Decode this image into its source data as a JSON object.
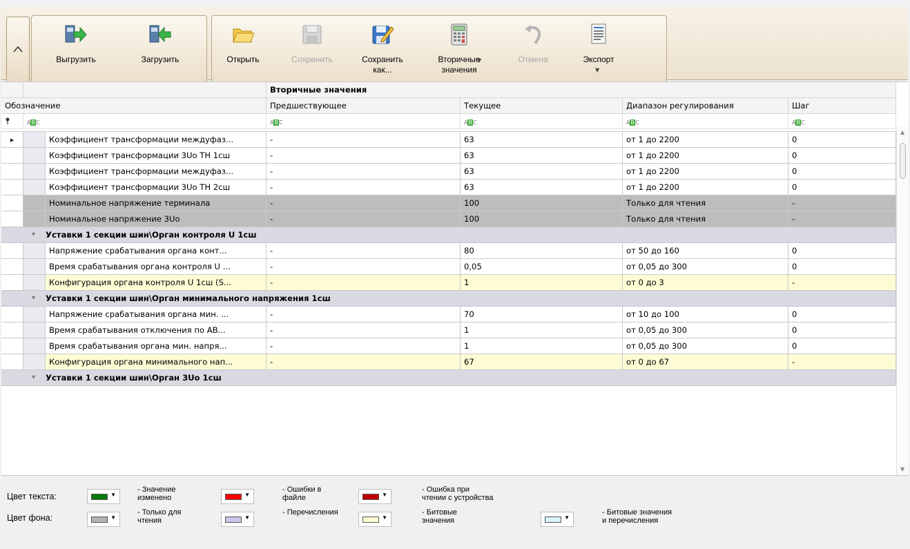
{
  "ribbon": {
    "collapse_glyph": "^",
    "buttons": [
      {
        "label": "Выгрузить",
        "icon": "upload-icon",
        "enabled": true
      },
      {
        "label": "Загрузить",
        "icon": "download-icon",
        "enabled": true
      },
      {
        "label": "Открыть",
        "icon": "folder-icon",
        "enabled": true
      },
      {
        "label": "Сохранить",
        "icon": "save-icon",
        "enabled": false
      },
      {
        "label": "Сохранить\nкак...",
        "icon": "save-as-icon",
        "enabled": true
      },
      {
        "label": "Вторичные\nзначения",
        "icon": "calculator-icon",
        "enabled": true
      },
      {
        "label": "Отмена",
        "icon": "undo-icon",
        "enabled": false
      },
      {
        "label": "Экспорт",
        "icon": "export-icon",
        "enabled": true
      }
    ]
  },
  "grid": {
    "band_header": "Вторичные значения",
    "columns": [
      "Обозначение",
      "Предшествующее",
      "Текущее",
      "Диапазон регулирования",
      "Шаг"
    ],
    "filter_icon": "ABC",
    "rows": [
      {
        "kind": "data",
        "style": "normal",
        "current": true,
        "name": "Коэффициент трансформации междуфаз...",
        "prev": "-",
        "cur": "63",
        "range": "от 1 до 2200",
        "step": "0"
      },
      {
        "kind": "data",
        "style": "normal",
        "name": "Коэффициент трансформации 3Uo ТН 1сш",
        "prev": "-",
        "cur": "63",
        "range": "от 1 до 2200",
        "step": "0"
      },
      {
        "kind": "data",
        "style": "normal",
        "name": "Коэффициент трансформации междуфаз...",
        "prev": "-",
        "cur": "63",
        "range": "от 1 до 2200",
        "step": "0"
      },
      {
        "kind": "data",
        "style": "normal",
        "name": "Коэффициент трансформации 3Uo ТН 2сш",
        "prev": "-",
        "cur": "63",
        "range": "от 1 до 2200",
        "step": "0"
      },
      {
        "kind": "data",
        "style": "ro",
        "name": "Номинальное напряжение терминала",
        "prev": "-",
        "cur": "100",
        "range": "Только для чтения",
        "step": "-"
      },
      {
        "kind": "data",
        "style": "ro",
        "name": "Номинальное напряжение 3Uo",
        "prev": "-",
        "cur": "100",
        "range": "Только для чтения",
        "step": "-"
      },
      {
        "kind": "group",
        "title": "Уставки 1 секции шин\\Орган контроля U 1сш"
      },
      {
        "kind": "data",
        "style": "normal",
        "name": "Напряжение срабатывания органа конт...",
        "prev": "-",
        "cur": "80",
        "range": "от 50 до 160",
        "step": "0"
      },
      {
        "kind": "data",
        "style": "normal",
        "name": "Время срабатывания органа контроля U ...",
        "prev": "-",
        "cur": "0,05",
        "range": "от 0,05 до 300",
        "step": "0"
      },
      {
        "kind": "data",
        "style": "bit",
        "name": "Конфигурация органа контроля U 1сш (S...",
        "prev": "-",
        "cur": "1",
        "range": "от 0 до 3",
        "step": "-"
      },
      {
        "kind": "group",
        "title": "Уставки 1 секции шин\\Орган минимального напряжения 1сш"
      },
      {
        "kind": "data",
        "style": "normal",
        "name": "Напряжение срабатывания органа мин. ...",
        "prev": "-",
        "cur": "70",
        "range": "от 10 до 100",
        "step": "0"
      },
      {
        "kind": "data",
        "style": "normal",
        "name": "Время срабатывания отключения по АВ...",
        "prev": "-",
        "cur": "1",
        "range": "от 0,05 до 300",
        "step": "0"
      },
      {
        "kind": "data",
        "style": "normal",
        "name": "Время срабатывания органа мин. напря...",
        "prev": "-",
        "cur": "1",
        "range": "от 0,05 до 300",
        "step": "0"
      },
      {
        "kind": "data",
        "style": "bit",
        "name": "Конфигурация органа минимального нап...",
        "prev": "-",
        "cur": "67",
        "range": "от 0 до 67",
        "step": "-"
      },
      {
        "kind": "group",
        "title": "Уставки 1 секции шин\\Орган 3Uo 1сш"
      }
    ]
  },
  "legend": {
    "text_color_label": "Цвет текста:",
    "bg_color_label": "Цвет фона:",
    "items": [
      {
        "row": "text",
        "color": "#0a7a0a",
        "desc": "- Значение\n  изменено"
      },
      {
        "row": "text",
        "color": "#ff0000",
        "desc": "- Ошибки в\n  файле"
      },
      {
        "row": "text",
        "color": "#c00000",
        "desc": "- Ошибка при\n  чтении с устройства"
      },
      {
        "row": "bg",
        "color": "#b4b4b4",
        "desc": "- Только для\n  чтения"
      },
      {
        "row": "bg",
        "color": "#c8c8ec",
        "desc": "- Перечисления"
      },
      {
        "row": "bg",
        "color": "#fefcd4",
        "desc": "- Битовые\n  значения"
      },
      {
        "row": "bg",
        "color": "#d8f4fa",
        "desc": "- Битовые значения\n  и перечисления"
      }
    ]
  }
}
